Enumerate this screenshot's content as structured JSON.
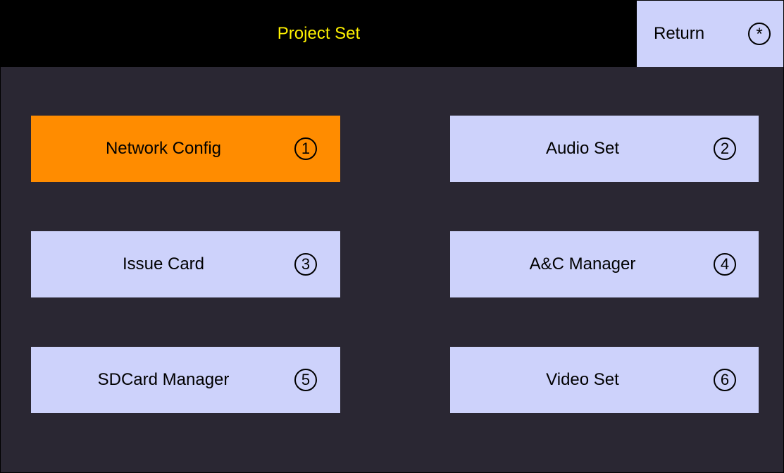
{
  "header": {
    "title": "Project Set",
    "return_label": "Return",
    "return_glyph": "*"
  },
  "menu": {
    "items": [
      {
        "label": "Network Config",
        "number": "1",
        "state": "selected"
      },
      {
        "label": "Audio Set",
        "number": "2"
      },
      {
        "label": "Issue Card",
        "number": "3"
      },
      {
        "label": "A&C Manager",
        "number": "4"
      },
      {
        "label": "SDCard Manager",
        "number": "5"
      },
      {
        "label": "Video Set",
        "number": "6"
      }
    ]
  },
  "colors": {
    "background": "#2a2733",
    "header": "#000000",
    "title_text": "#fff200",
    "button": "#cdd2fb",
    "selected_button": "#ff8c00"
  },
  "icons": {
    "return": "asterisk-circle-icon",
    "number_badge": "circled-number-icon"
  }
}
